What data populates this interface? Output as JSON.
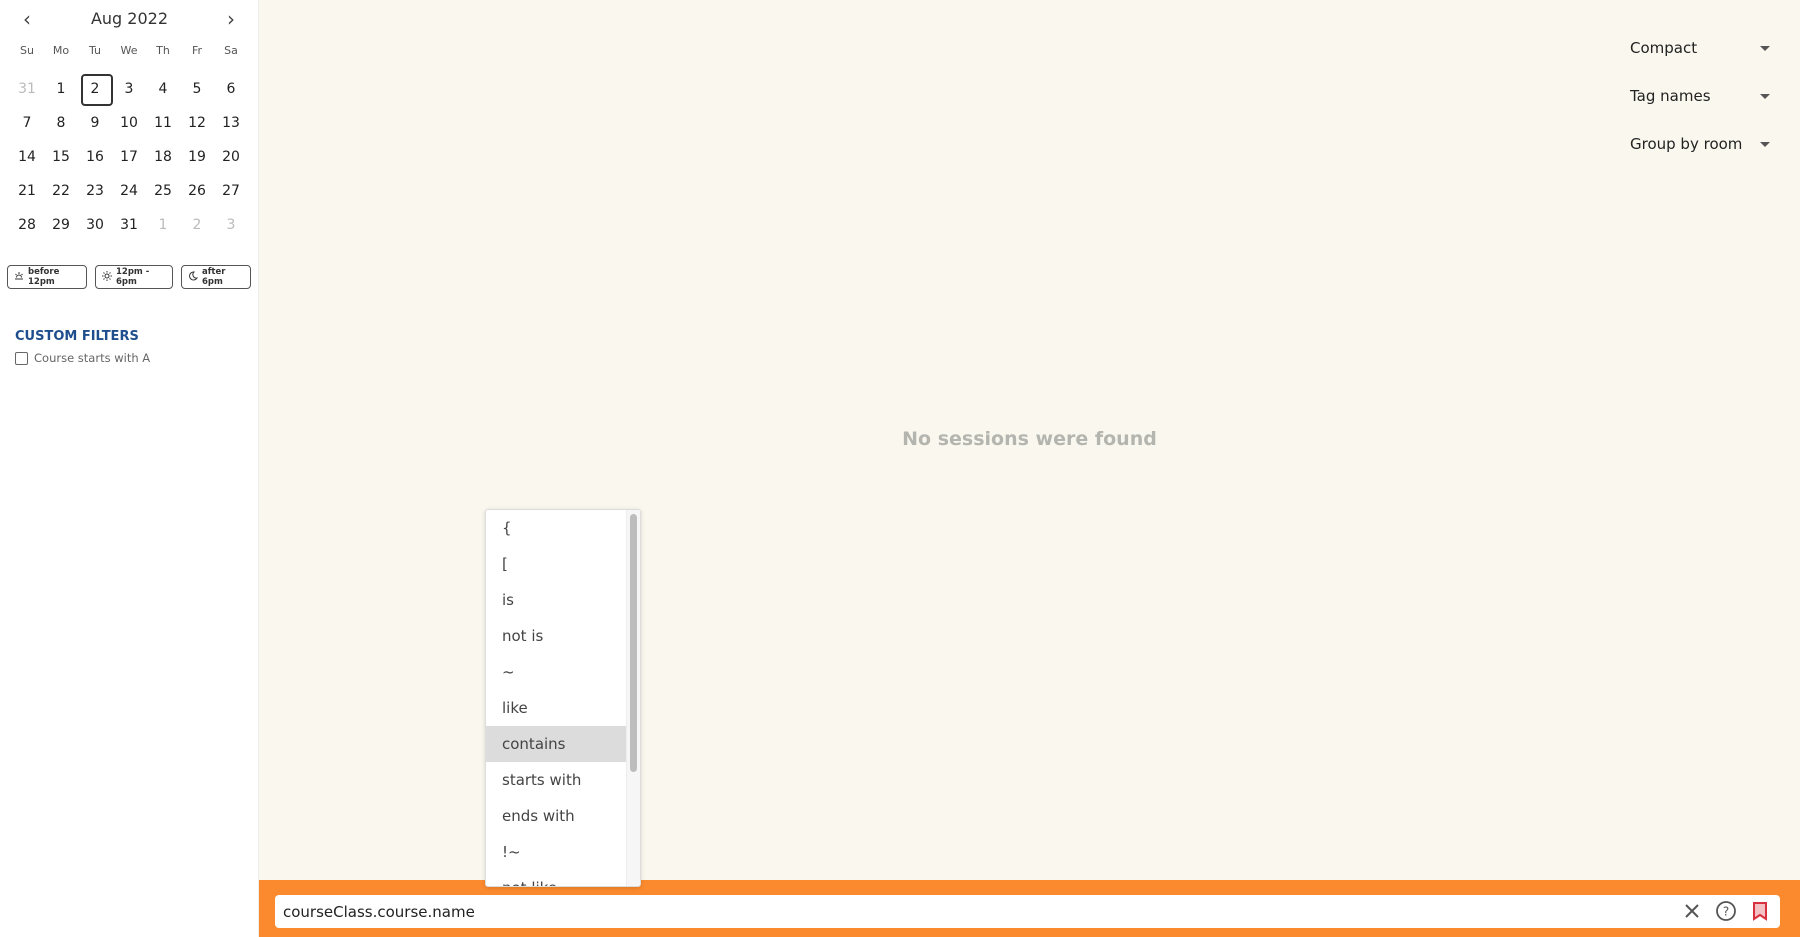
{
  "calendar": {
    "title": "Aug 2022",
    "weekdays": [
      "Su",
      "Mo",
      "Tu",
      "We",
      "Th",
      "Fr",
      "Sa"
    ],
    "days": [
      [
        "31",
        1
      ],
      [
        "1",
        0
      ],
      [
        "2",
        2
      ],
      [
        "3",
        0
      ],
      [
        "4",
        0
      ],
      [
        "5",
        0
      ],
      [
        "6",
        0
      ],
      [
        "7",
        0
      ],
      [
        "8",
        0
      ],
      [
        "9",
        0
      ],
      [
        "10",
        0
      ],
      [
        "11",
        0
      ],
      [
        "12",
        0
      ],
      [
        "13",
        0
      ],
      [
        "14",
        0
      ],
      [
        "15",
        0
      ],
      [
        "16",
        0
      ],
      [
        "17",
        0
      ],
      [
        "18",
        0
      ],
      [
        "19",
        0
      ],
      [
        "20",
        0
      ],
      [
        "21",
        0
      ],
      [
        "22",
        0
      ],
      [
        "23",
        0
      ],
      [
        "24",
        0
      ],
      [
        "25",
        0
      ],
      [
        "26",
        0
      ],
      [
        "27",
        0
      ],
      [
        "28",
        0
      ],
      [
        "29",
        0
      ],
      [
        "30",
        0
      ],
      [
        "31",
        0
      ],
      [
        "1",
        1
      ],
      [
        "2",
        1
      ],
      [
        "3",
        1
      ]
    ],
    "selected": "2"
  },
  "time_filters": [
    {
      "label": "before 12pm",
      "icon": "sunrise-icon"
    },
    {
      "label": "12pm - 6pm",
      "icon": "sun-icon"
    },
    {
      "label": "after 6pm",
      "icon": "moon-icon"
    }
  ],
  "custom_filters": {
    "title": "CUSTOM FILTERS",
    "items": [
      {
        "label": "Course starts with A",
        "checked": false
      }
    ]
  },
  "view_options": [
    "Compact",
    "Tag names",
    "Group by room"
  ],
  "empty_message": "No sessions were found",
  "query": {
    "value": "courseClass.course.name"
  },
  "autocomplete": {
    "items": [
      "{",
      "[",
      "is",
      "not is",
      "~",
      "like",
      "contains",
      "starts with",
      "ends with",
      "!~",
      "not like"
    ],
    "highlighted": "contains"
  },
  "colors": {
    "accent": "#fb8a2e",
    "heading": "#1f4e8c",
    "bookmark": "#d9303e"
  }
}
